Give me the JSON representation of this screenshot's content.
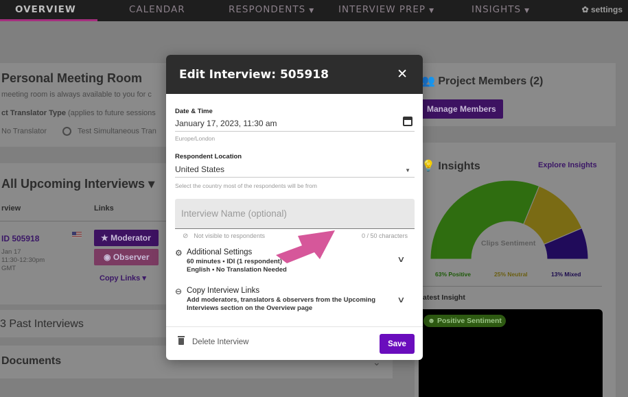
{
  "nav": {
    "tabs": [
      {
        "label": "OVERVIEW"
      },
      {
        "label": "CALENDAR"
      },
      {
        "label": "RESPONDENTS"
      },
      {
        "label": "INTERVIEW PREP"
      },
      {
        "label": "INSIGHTS"
      }
    ],
    "caret": "▼",
    "settings": "settings"
  },
  "background": {
    "pmr_title": "Personal Meeting Room",
    "pmr_text": "meeting room is always available to you for c",
    "translator_type_bold": "ct Translator Type",
    "translator_type_rest": " (applies to future sessions",
    "radio_1": "No Translator",
    "radio_2": "Test Simultaneous Tran",
    "upcoming_title": "All Upcoming Interviews",
    "upcoming_caret": "▾",
    "col_view": "rview",
    "col_links": "Links",
    "row_id": "ID 505918",
    "row_date": "Jan 17",
    "row_time": "11:30-12:30pm",
    "row_tz": "GMT",
    "btn_moderator": "Moderator",
    "btn_observer": "Observer",
    "copy_links": "Copy Links",
    "copy_links_caret": "▾",
    "past_title": "3 Past Interviews",
    "documents_title": "Documents",
    "documents_caret": "⌄",
    "members_title": "Project Members (2)",
    "manage_members": "Manage Members",
    "insights_title": "Insights",
    "explore_insights": "Explore Insights",
    "clips_sentiment": "Clips Sentiment",
    "latest_insight": "atest Insight",
    "positive_sentiment": "Positive Sentiment",
    "legend": [
      {
        "label": "63% Positive",
        "color": "#1e5a09"
      },
      {
        "label": "25% Neutral",
        "color": "#6b5f12"
      },
      {
        "label": "13% Mixed",
        "color": "#1b0a4d"
      }
    ]
  },
  "sentiment": [
    {
      "name": "Positive",
      "pct": 63,
      "color": "#2f6d10"
    },
    {
      "name": "Neutral",
      "pct": 25,
      "color": "#7a6b14"
    },
    {
      "name": "Mixed",
      "pct": 13,
      "color": "#200b5a"
    }
  ],
  "modal": {
    "title": "Edit Interview: 505918",
    "close": "✕",
    "date_label": "Date & Time",
    "date_value": "January 17, 2023, 11:30 am",
    "timezone": "Europe/London",
    "location_label": "Respondent Location",
    "location_value": "United States",
    "location_caret": "▼",
    "location_hint": "Select the country most of the respondents will be from",
    "name_placeholder": "Interview Name (optional)",
    "name_value": "",
    "not_visible": "Not visible to respondents",
    "char_count": "0 / 50 characters",
    "additional_title": "Additional Settings",
    "additional_line1": "60 minutes • IDI (1 respondent)",
    "additional_line2": "English • No Translation Needed",
    "copy_title": "Copy Interview Links",
    "copy_line1": "Add moderators, translators & observers from the Upcoming",
    "copy_line2": "Interviews section on the Overview page",
    "chevron": "∨",
    "delete_label": "Delete Interview",
    "save_label": "Save"
  },
  "colors": {
    "accent": "#6a0dbd",
    "annotation_arrow": "#d6579a"
  }
}
